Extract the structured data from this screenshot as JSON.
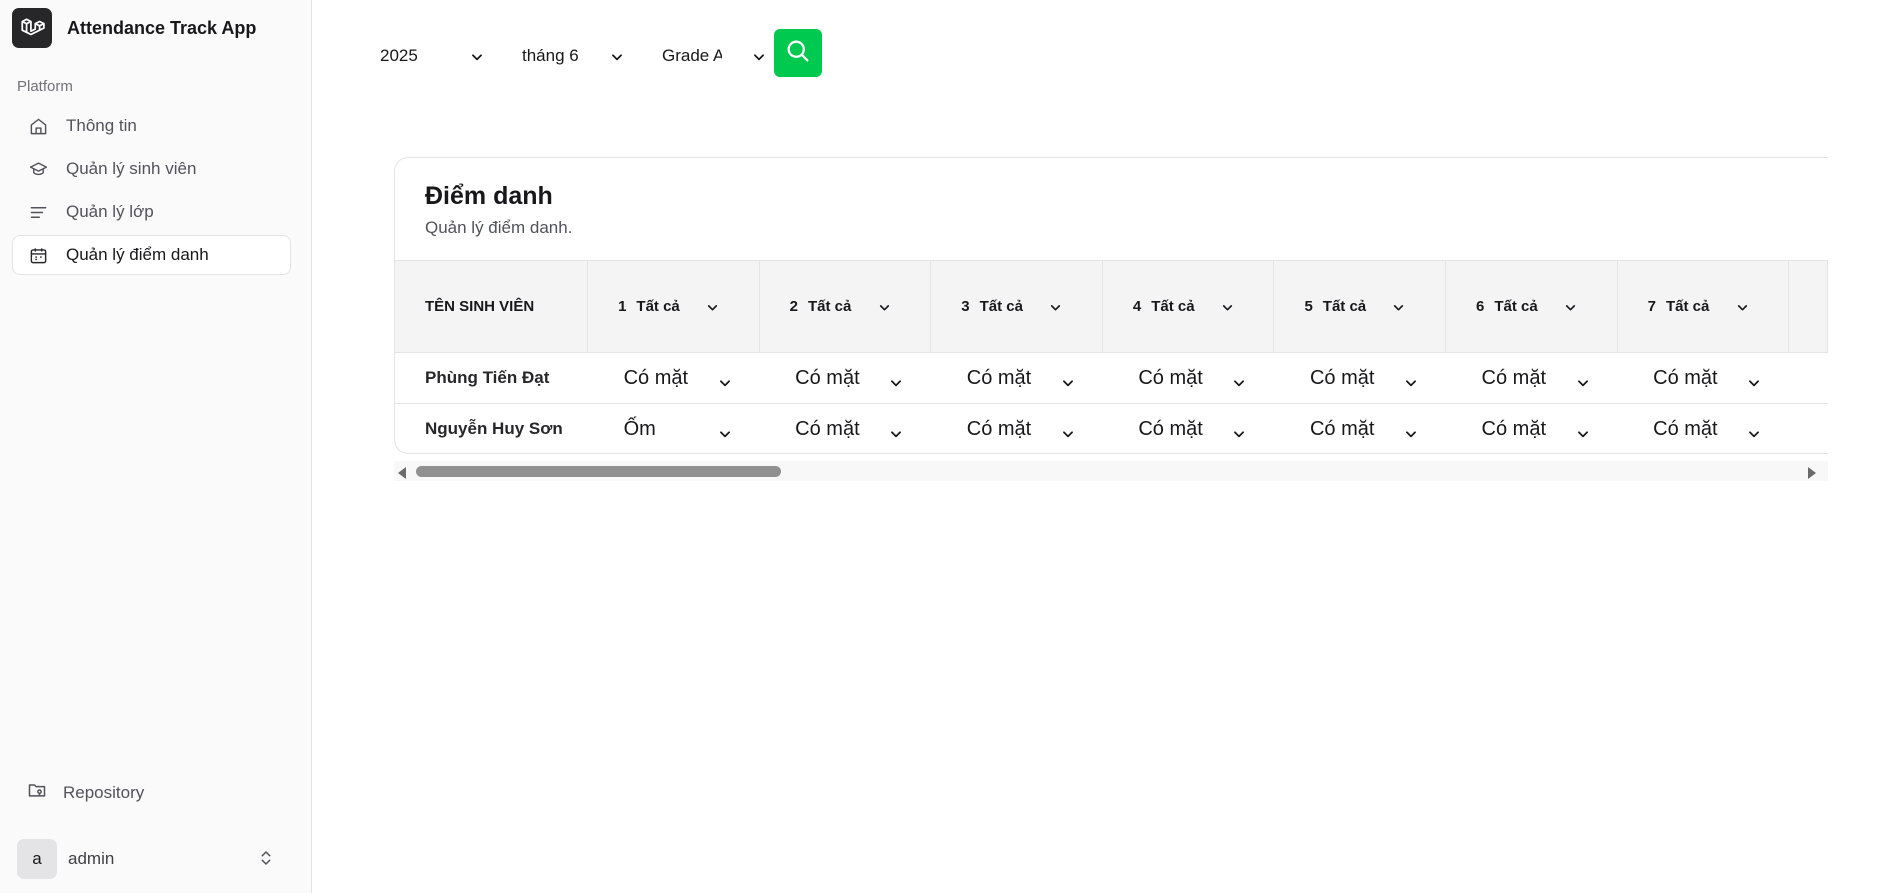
{
  "app": {
    "title": "Attendance Track App"
  },
  "sidebar": {
    "section_label": "Platform",
    "items": [
      {
        "label": "Thông tin",
        "icon": "home-icon"
      },
      {
        "label": "Quản lý sinh viên",
        "icon": "graduation-cap-icon"
      },
      {
        "label": "Quản lý lớp",
        "icon": "list-lines-icon"
      },
      {
        "label": "Quản lý điểm danh",
        "icon": "calendar-icon",
        "active": true
      }
    ],
    "repository_label": "Repository",
    "user": {
      "initial": "a",
      "name": "admin"
    }
  },
  "filters": {
    "year": "2025",
    "month": "tháng 6",
    "grade": "Grade A",
    "search_icon": "search-icon"
  },
  "card": {
    "title": "Điểm danh",
    "subtitle": "Quản lý điểm danh."
  },
  "table": {
    "name_header": "TÊN SINH VIÊN",
    "day_filter_label": "Tất cả",
    "days": [
      "1",
      "2",
      "3",
      "4",
      "5",
      "6",
      "7"
    ],
    "rows": [
      {
        "name": "Phùng Tiến Đạt",
        "statuses": [
          "Có mặt",
          "Có mặt",
          "Có mặt",
          "Có mặt",
          "Có mặt",
          "Có mặt",
          "Có mặt"
        ]
      },
      {
        "name": "Nguyễn Huy Sơn",
        "statuses": [
          "Ốm",
          "Có mặt",
          "Có mặt",
          "Có mặt",
          "Có mặt",
          "Có mặt",
          "Có mặt"
        ]
      }
    ]
  },
  "colors": {
    "accent_green": "#00c950",
    "sidebar_bg": "#fafafa",
    "logo_bg": "#27272a"
  }
}
